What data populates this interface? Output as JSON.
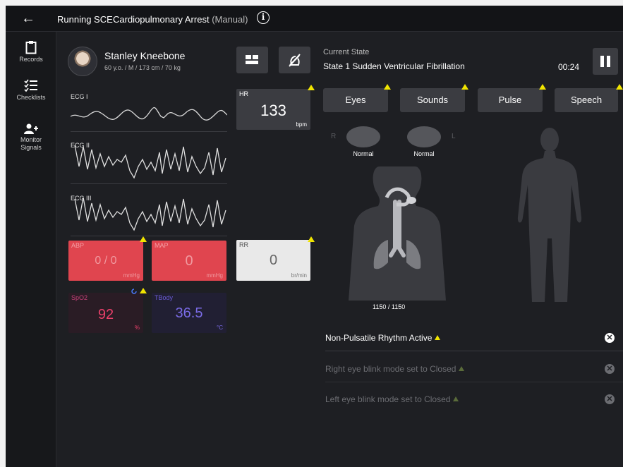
{
  "header": {
    "back_icon": "arrow-left-icon",
    "title_running": "Running SCE",
    "title_scenario": "Cardiopulmonary Arrest",
    "title_mode": "(Manual)",
    "info_icon": "info-icon"
  },
  "nav": {
    "items": [
      {
        "label": "Records",
        "icon": "clipboard-icon"
      },
      {
        "label": "Checklists",
        "icon": "checklist-icon"
      },
      {
        "label": "Monitor Signals",
        "icon": "person-plus-icon"
      }
    ]
  },
  "patient": {
    "name": "Stanley Kneebone",
    "info": "60 y.o. / M / 173 cm / 70 kg"
  },
  "ecg": {
    "lead1": "ECG I",
    "lead2": "ECG II",
    "lead3": "ECG III"
  },
  "vitals": {
    "hr": {
      "label": "HR",
      "value": "133",
      "unit": "bpm"
    },
    "abp": {
      "label": "ABP",
      "value": "0 / 0",
      "unit": "mmHg",
      "color": "#e0454f"
    },
    "map": {
      "label": "MAP",
      "value": "0",
      "unit": "mmHg",
      "color": "#e0454f"
    },
    "rr": {
      "label": "RR",
      "value": "0",
      "unit": "br/min"
    },
    "spo2": {
      "label": "SpO2",
      "value": "92",
      "unit": "%",
      "color": "#e9406a"
    },
    "tbody": {
      "label": "TBody",
      "value": "36.5",
      "unit": "°C",
      "color": "#6a5bd6"
    }
  },
  "state": {
    "label": "Current State",
    "value": "State 1 Sudden Ventricular Fibrillation",
    "timer": "00:24"
  },
  "tabs": [
    {
      "label": "Eyes"
    },
    {
      "label": "Sounds"
    },
    {
      "label": "Pulse"
    },
    {
      "label": "Speech"
    }
  ],
  "eyes": {
    "right_side": "R",
    "left_side": "L",
    "right_status": "Normal",
    "left_status": "Normal"
  },
  "ventilation": {
    "readout": "1150 / 1150"
  },
  "alerts": [
    {
      "text": "Non-Pulsatile Rhythm Active",
      "active": true
    },
    {
      "text": "Right eye blink mode set to Closed",
      "active": false
    },
    {
      "text": "Left eye blink mode set to Closed",
      "active": false
    }
  ],
  "colors": {
    "warning": "#f0e400",
    "danger_tile": "#e0454f",
    "panel": "#3b3c41",
    "background": "#1e1f23"
  }
}
